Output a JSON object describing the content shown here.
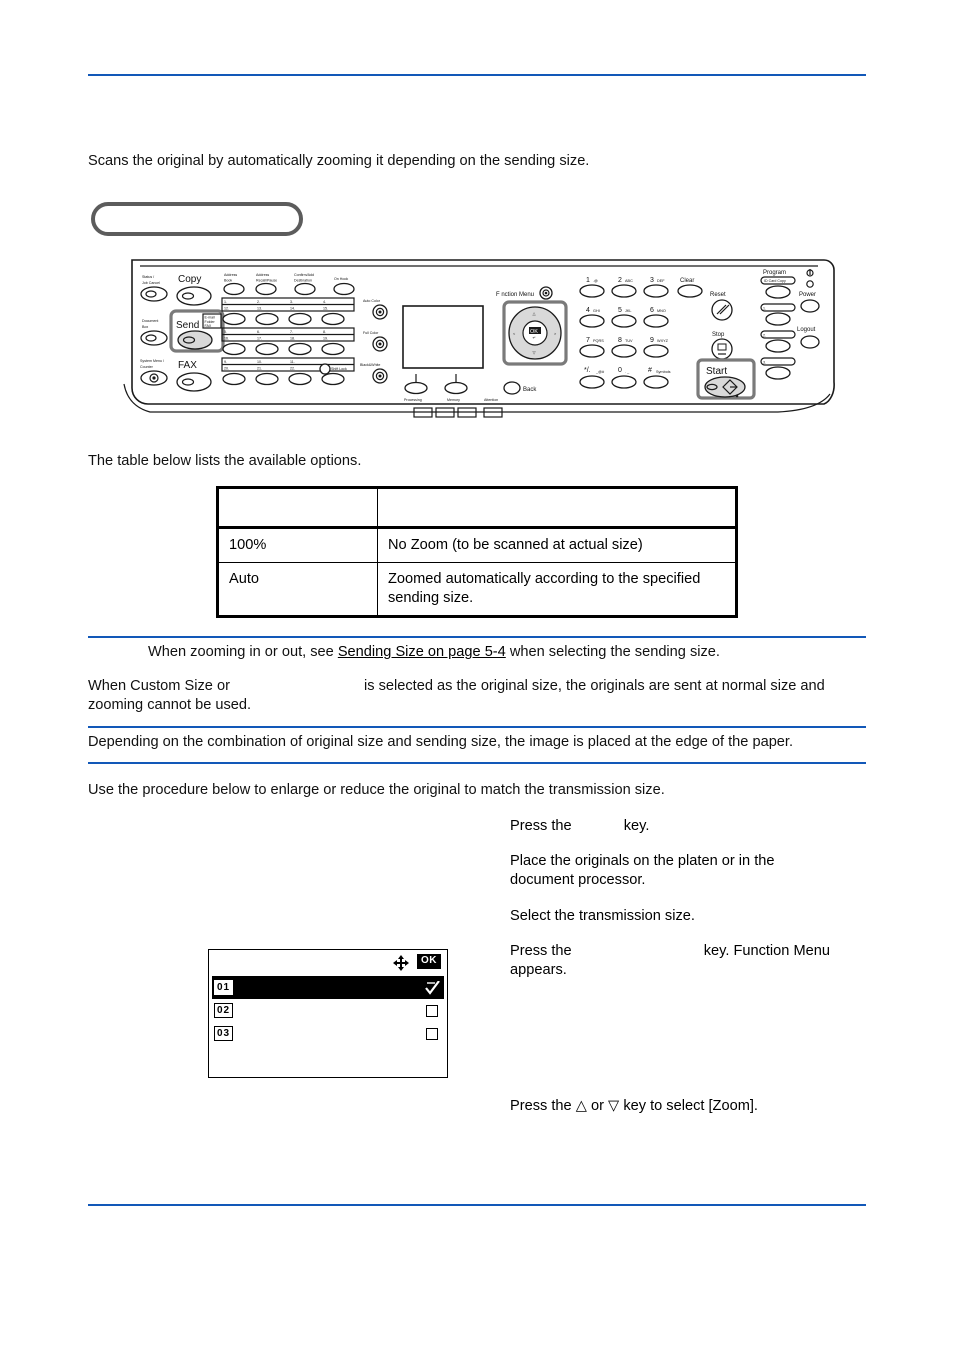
{
  "page": {
    "accent_color": "#1258b8",
    "rule_color": "#1258b8",
    "background": "#ffffff"
  },
  "intro": {
    "lead": "Scans the original by automatically zooming it depending on the sending size.",
    "heading_placeholder": ""
  },
  "control_panel": {
    "caption": "",
    "left_keys": [
      {
        "label": "Status / Job Cancel"
      },
      {
        "label": "Document Box"
      },
      {
        "label": "System Menu / Counter"
      }
    ],
    "mode_keys": [
      {
        "label": "Copy"
      },
      {
        "label": "Send",
        "sub": "E-mail Folder FAX",
        "highlighted": true
      },
      {
        "label": "FAX"
      }
    ],
    "send_sub_lines": [
      "E-mail",
      "Folder",
      "FAX"
    ],
    "address_keys": [
      {
        "label": "Address Book"
      },
      {
        "label": "Address Recall/Pause"
      },
      {
        "label": "Confirm/Add Destination"
      },
      {
        "label": "On Hook"
      }
    ],
    "one_touch_rows": [
      {
        "top": [
          "1.",
          "2.",
          "3.",
          "4."
        ],
        "bottom": [
          "12.",
          "13.",
          "14.",
          "15."
        ]
      },
      {
        "top": [
          "5.",
          "6.",
          "7.",
          "8."
        ],
        "bottom": [
          "16.",
          "17.",
          "18.",
          "19."
        ]
      },
      {
        "top": [
          "9.",
          "10.",
          "11.",
          ""
        ],
        "bottom": [
          "20.",
          "21.",
          "22.",
          ""
        ]
      }
    ],
    "shift_lock_label": "Shift Lock",
    "color_keys": [
      {
        "label": "Auto Color"
      },
      {
        "label": "Full Color"
      },
      {
        "label": "Black&White"
      }
    ],
    "indicators": [
      {
        "label": "Processing"
      },
      {
        "label": "Memory"
      },
      {
        "label": "Attention"
      }
    ],
    "function_menu_label": "Function Menu",
    "back_label": "Back",
    "arrow_pad": {
      "ok_label": "OK",
      "up": "△",
      "down": "▽",
      "left": "◁",
      "right": "▷"
    },
    "keypad": [
      {
        "digit": "1",
        "letters": ".@"
      },
      {
        "digit": "2",
        "letters": "ABC"
      },
      {
        "digit": "3",
        "letters": "DEF"
      },
      {
        "digit": "4",
        "letters": "GHI"
      },
      {
        "digit": "5",
        "letters": "JKL"
      },
      {
        "digit": "6",
        "letters": "MNO"
      },
      {
        "digit": "7",
        "letters": "PQRS"
      },
      {
        "digit": "8",
        "letters": "TUV"
      },
      {
        "digit": "9",
        "letters": "WXYZ"
      },
      {
        "digit": "*/.",
        "letters": "_@#"
      },
      {
        "digit": "0",
        "letters": ". _"
      },
      {
        "digit": "#",
        "letters": "Symbols"
      }
    ],
    "clear_label": "Clear",
    "reset_label": "Reset",
    "stop_label": "Stop",
    "start_label": "Start",
    "program_label": "Program",
    "program_sub": "ID Card Copy",
    "power_label": "Power",
    "logout_label": "Logout",
    "quick_keys": [
      "1.",
      "2.",
      "3."
    ]
  },
  "table_section": {
    "lead": "The table below lists the available options.",
    "headers": [
      "",
      ""
    ],
    "rows": [
      {
        "option": "100%",
        "description": "No Zoom (to be scanned at actual size)"
      },
      {
        "option": "Auto",
        "description": "Zoomed automatically according to the specified sending size."
      }
    ]
  },
  "notes": {
    "note1_pre": "When zooming in or out, see ",
    "note1_link": "Sending Size on page 5-4",
    "note1_post": " when selecting the sending size.",
    "note2_pre": "When Custom Size or ",
    "note2_mid": "is selected as the original size, the originals are sent at normal size and",
    "note2_second_line": "zooming cannot be used.",
    "note3": "Depending on the combination of original size and sending size, the image is placed at the edge of the paper."
  },
  "procedure": {
    "lead": "Use the procedure below to enlarge or reduce the original to match the transmission size.",
    "steps": [
      {
        "pre": "Press the ",
        "blank": true,
        "post": "key."
      },
      {
        "pre": "Place the originals on the platen or in the",
        "post": "document processor."
      },
      {
        "pre": "Select the transmission size.",
        "post": ""
      },
      {
        "pre": "Press the ",
        "blank": true,
        "post": "key. Function Menu",
        "second": "appears."
      },
      {
        "pre": "Press the ",
        "up": "△",
        "mid": " or ",
        "down": "▽",
        "post": " key to select [Zoom]."
      }
    ]
  },
  "lcd": {
    "ok_label": "OK",
    "nav_icon": "four-way-arrow-icon",
    "rows": [
      {
        "number": "01",
        "selected": true,
        "checked": true
      },
      {
        "number": "02",
        "selected": false,
        "checked": false
      },
      {
        "number": "03",
        "selected": false,
        "checked": false
      }
    ]
  }
}
